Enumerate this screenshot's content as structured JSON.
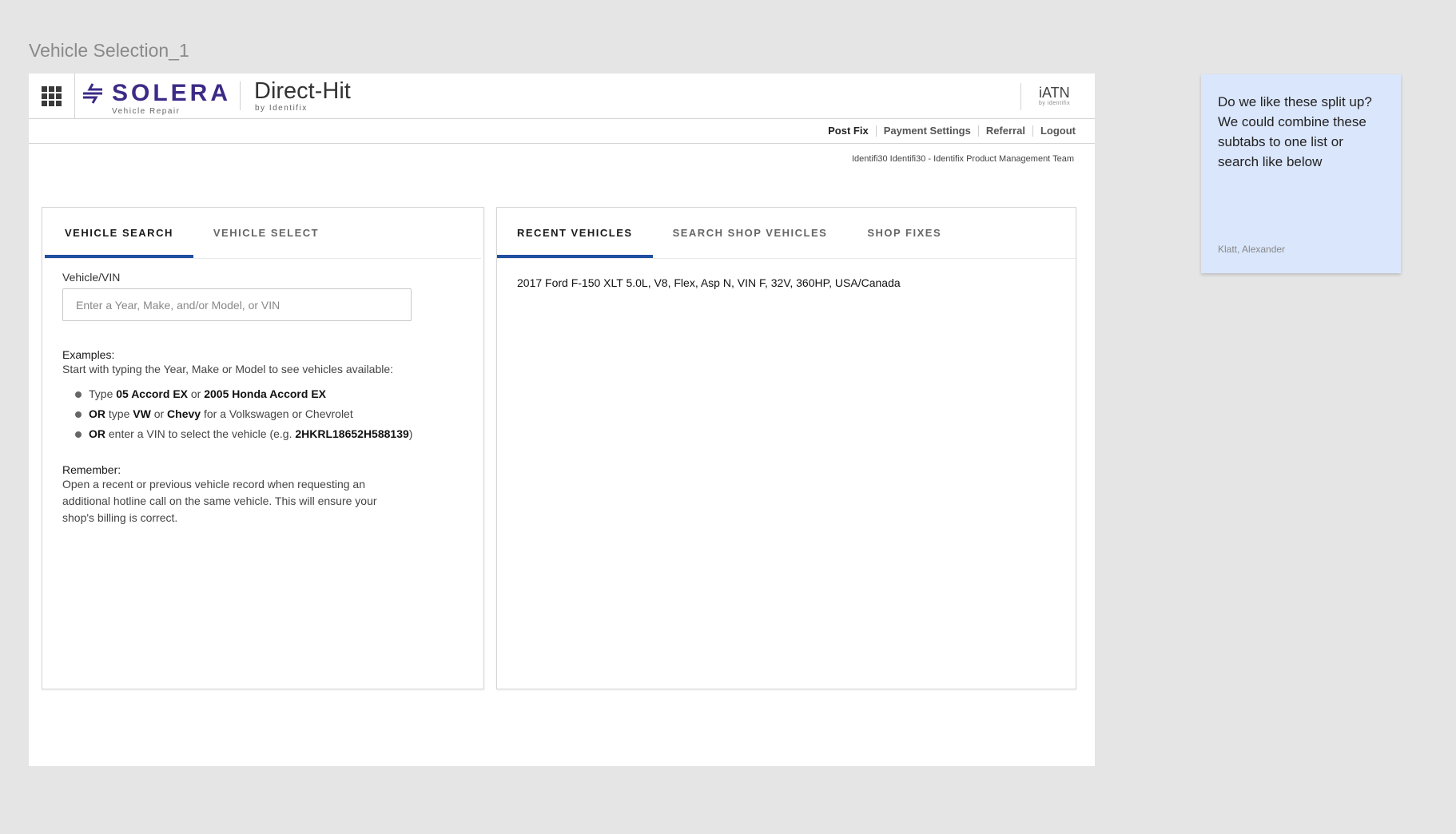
{
  "frame_title": "Vehicle Selection_1",
  "header": {
    "brand": "SOLERA",
    "brand_sub": "Vehicle Repair",
    "product": "Direct-Hit",
    "product_sub": "by Identifix",
    "partner": "iATN",
    "partner_sub": "by identifix"
  },
  "utility_nav": [
    "Post Fix",
    "Payment Settings",
    "Referral",
    "Logout"
  ],
  "account_text": "Identifi30 Identifi30 - Identifix Product Management Team",
  "left_panel": {
    "tabs": [
      "VEHICLE SEARCH",
      "VEHICLE SELECT"
    ],
    "field_label": "Vehicle/VIN",
    "input_placeholder": "Enter a Year, Make, and/or Model, or VIN",
    "examples_title": "Examples:",
    "examples_intro": "Start with typing the Year, Make or Model to see vehicles available:",
    "example_1": {
      "a": "Type ",
      "b": "05 Accord EX",
      "c": " or ",
      "d": "2005 Honda Accord EX"
    },
    "example_2": {
      "a": "OR",
      "b": " type ",
      "c": "VW",
      "d": " or ",
      "e": "Chevy",
      "f": " for a Volkswagen or Chevrolet"
    },
    "example_3": {
      "a": "OR",
      "b": " enter a VIN to select the vehicle (e.g. ",
      "c": "2HKRL18652H588139",
      "d": ")"
    },
    "remember_title": "Remember:",
    "remember_text": "Open a recent or previous vehicle record when requesting an additional hotline call on the same vehicle. This will ensure your shop's billing is correct."
  },
  "right_panel": {
    "tabs": [
      "RECENT VEHICLES",
      "SEARCH SHOP VEHICLES",
      "SHOP FIXES"
    ],
    "recent_vehicles": [
      "2017 Ford F-150 XLT 5.0L, V8, Flex, Asp N, VIN F, 32V, 360HP, USA/Canada"
    ]
  },
  "sticky_note": {
    "text": "Do we like these split up? We could combine these subtabs to one list or search like below",
    "author": "Klatt, Alexander"
  },
  "colors": {
    "brand_purple": "#3d2a86",
    "tab_active_underline": "#1f4fa0",
    "sticky_bg": "#dae6fb",
    "canvas_bg": "#e5e5e5"
  }
}
